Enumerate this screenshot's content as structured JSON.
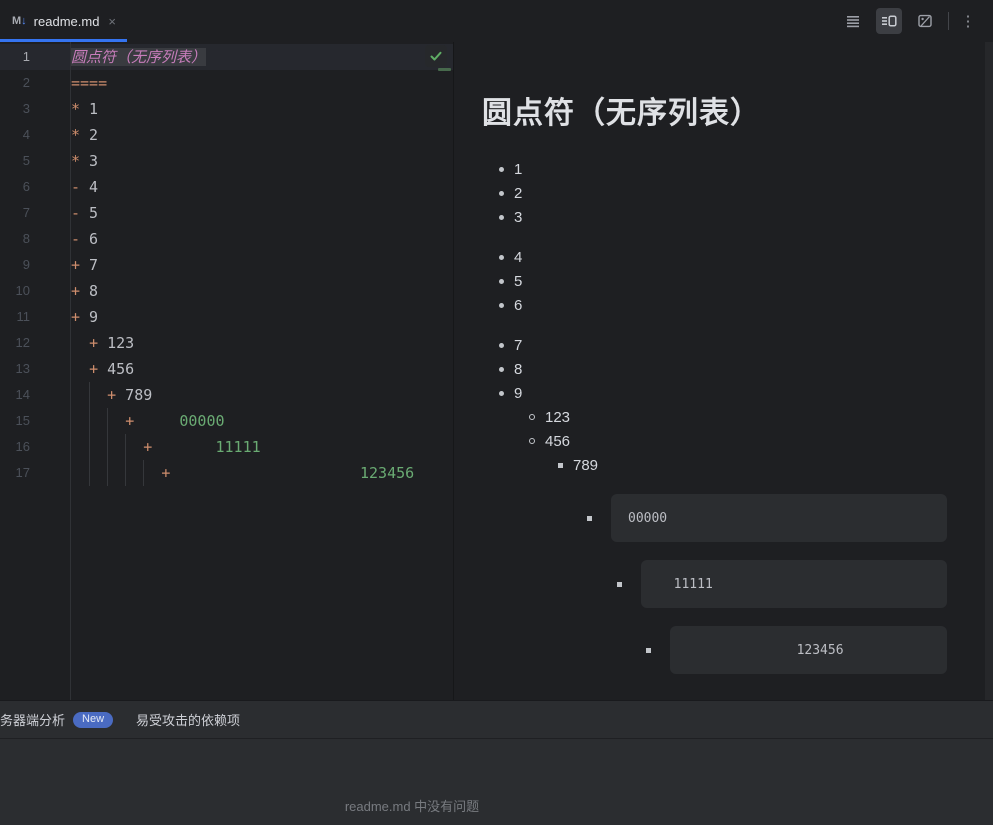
{
  "tab": {
    "file_icon_m": "M",
    "file_icon_arrow": "↓",
    "title": "readme.md",
    "close_glyph": "×"
  },
  "toolbar": {
    "icons": [
      "editor-only",
      "editor-and-preview",
      "preview-only",
      "more-options"
    ],
    "selected": "editor-and-preview",
    "kebab_glyph": "⋮"
  },
  "colors": {
    "accent_blue": "#3574F0",
    "marker_orange": "#CF8E6D",
    "code_green": "#6AAB73",
    "heading_pink": "#C77DBB",
    "badge_blue": "#4A6BC2",
    "check_green": "#5FAD65"
  },
  "editor": {
    "lines": [
      {
        "num": "1",
        "guides": [],
        "parts": [
          {
            "t": "圆点符（无序列表）",
            "c": "heading"
          }
        ]
      },
      {
        "num": "2",
        "guides": [],
        "parts": [
          {
            "t": "====",
            "c": "marker"
          }
        ]
      },
      {
        "num": "3",
        "guides": [],
        "parts": [
          {
            "t": "*",
            "c": "marker"
          },
          {
            "t": " 1",
            "c": "plain"
          }
        ]
      },
      {
        "num": "4",
        "guides": [],
        "parts": [
          {
            "t": "*",
            "c": "marker"
          },
          {
            "t": " 2",
            "c": "plain"
          }
        ]
      },
      {
        "num": "5",
        "guides": [],
        "parts": [
          {
            "t": "*",
            "c": "marker"
          },
          {
            "t": " 3",
            "c": "plain"
          }
        ]
      },
      {
        "num": "6",
        "guides": [],
        "parts": [
          {
            "t": "-",
            "c": "marker"
          },
          {
            "t": " 4",
            "c": "plain"
          }
        ]
      },
      {
        "num": "7",
        "guides": [],
        "parts": [
          {
            "t": "-",
            "c": "marker"
          },
          {
            "t": " 5",
            "c": "plain"
          }
        ]
      },
      {
        "num": "8",
        "guides": [],
        "parts": [
          {
            "t": "-",
            "c": "marker"
          },
          {
            "t": " 6",
            "c": "plain"
          }
        ]
      },
      {
        "num": "9",
        "guides": [],
        "parts": [
          {
            "t": "+",
            "c": "marker"
          },
          {
            "t": " 7",
            "c": "plain"
          }
        ]
      },
      {
        "num": "10",
        "guides": [],
        "parts": [
          {
            "t": "+",
            "c": "marker"
          },
          {
            "t": " 8",
            "c": "plain"
          }
        ]
      },
      {
        "num": "11",
        "guides": [],
        "parts": [
          {
            "t": "+",
            "c": "marker"
          },
          {
            "t": " 9",
            "c": "plain"
          }
        ]
      },
      {
        "num": "12",
        "guides": [],
        "parts": [
          {
            "t": "  ",
            "c": "plain"
          },
          {
            "t": "+",
            "c": "marker"
          },
          {
            "t": " 123",
            "c": "plain"
          }
        ]
      },
      {
        "num": "13",
        "guides": [],
        "parts": [
          {
            "t": "  ",
            "c": "plain"
          },
          {
            "t": "+",
            "c": "marker"
          },
          {
            "t": " 456",
            "c": "plain"
          }
        ]
      },
      {
        "num": "14",
        "guides": [
          2
        ],
        "parts": [
          {
            "t": "    ",
            "c": "plain"
          },
          {
            "t": "+",
            "c": "marker"
          },
          {
            "t": " 789",
            "c": "plain"
          }
        ]
      },
      {
        "num": "15",
        "guides": [
          2,
          4
        ],
        "parts": [
          {
            "t": "      ",
            "c": "plain"
          },
          {
            "t": "+",
            "c": "marker"
          },
          {
            "t": "     ",
            "c": "plain"
          },
          {
            "t": "00000",
            "c": "code"
          }
        ]
      },
      {
        "num": "16",
        "guides": [
          2,
          4,
          6
        ],
        "parts": [
          {
            "t": "        ",
            "c": "plain"
          },
          {
            "t": "+",
            "c": "marker"
          },
          {
            "t": "       ",
            "c": "plain"
          },
          {
            "t": "11111",
            "c": "code"
          }
        ]
      },
      {
        "num": "17",
        "guides": [
          2,
          4,
          6,
          8
        ],
        "parts": [
          {
            "t": "          ",
            "c": "plain"
          },
          {
            "t": "+",
            "c": "marker"
          },
          {
            "t": "                     ",
            "c": "plain"
          },
          {
            "t": "123456",
            "c": "code"
          }
        ]
      }
    ]
  },
  "preview": {
    "heading": "圆点符（无序列表）",
    "rows": [
      {
        "type": "item",
        "level": 1,
        "bullet": "disc",
        "text": "1"
      },
      {
        "type": "item",
        "level": 1,
        "bullet": "disc",
        "text": "2"
      },
      {
        "type": "item",
        "level": 1,
        "bullet": "disc",
        "text": "3"
      },
      {
        "type": "item",
        "level": 1,
        "bullet": "disc",
        "text": "4",
        "gap": true
      },
      {
        "type": "item",
        "level": 1,
        "bullet": "disc",
        "text": "5"
      },
      {
        "type": "item",
        "level": 1,
        "bullet": "disc",
        "text": "6"
      },
      {
        "type": "item",
        "level": 1,
        "bullet": "disc",
        "text": "7",
        "gap": true
      },
      {
        "type": "item",
        "level": 1,
        "bullet": "disc",
        "text": "8"
      },
      {
        "type": "item",
        "level": 1,
        "bullet": "disc",
        "text": "9"
      },
      {
        "type": "item",
        "level": 2,
        "bullet": "circle",
        "text": "123"
      },
      {
        "type": "item",
        "level": 2,
        "bullet": "circle",
        "text": "456"
      },
      {
        "type": "item",
        "level": 3,
        "bullet": "square",
        "text": "789"
      },
      {
        "type": "code",
        "level": 4,
        "bullet": "square",
        "text": "00000"
      },
      {
        "type": "code",
        "level": 5,
        "bullet": "square",
        "text": "  11111"
      },
      {
        "type": "code",
        "level": 6,
        "bullet": "square",
        "text": "              123456"
      }
    ]
  },
  "problems": {
    "tab_server_analysis": "务器端分析",
    "badge_new": "New",
    "tab_vulnerable_deps": "易受攻击的依赖项",
    "empty_message": "readme.md 中没有问题"
  }
}
